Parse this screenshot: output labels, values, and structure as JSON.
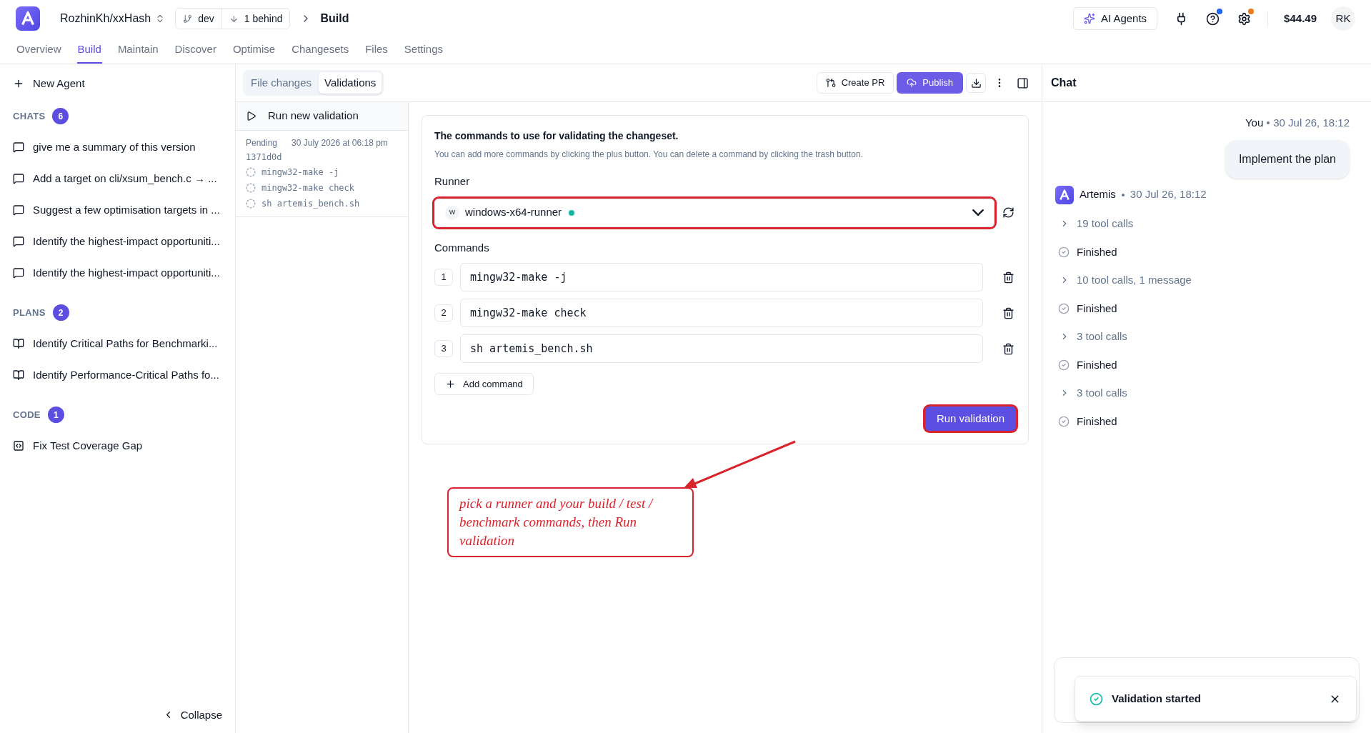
{
  "header": {
    "repo": "RozhinKh/xxHash",
    "branch": "dev",
    "behind": "1 behind",
    "breadcrumb": "Build",
    "ai_agents": "AI Agents",
    "icon_buttons": [
      {
        "kind": "plug"
      },
      {
        "kind": "help",
        "color": "#1d64f2"
      },
      {
        "kind": "settings",
        "color": "#ea7a1c"
      }
    ],
    "balance": "$44.49",
    "avatar": "RK"
  },
  "nav_tabs": [
    {
      "label": "Overview",
      "selected": false
    },
    {
      "label": "Build",
      "selected": true
    },
    {
      "label": "Maintain",
      "selected": false
    },
    {
      "label": "Discover",
      "selected": false
    },
    {
      "label": "Optimise",
      "selected": false
    },
    {
      "label": "Changesets",
      "selected": false
    },
    {
      "label": "Files",
      "selected": false
    },
    {
      "label": "Settings",
      "selected": false
    }
  ],
  "sidebar": {
    "new_agent": "New Agent",
    "collapse": "Collapse",
    "sections": [
      {
        "kind": "chat",
        "title": "CHATS",
        "count": "6",
        "items": [
          "give me a summary of this version",
          "Add a target on cli/xsum_bench.c → ...",
          "Suggest a few optimisation targets in ...",
          "Identify the highest-impact opportuniti...",
          "Identify the highest-impact opportuniti..."
        ]
      },
      {
        "kind": "plan",
        "title": "PLANS",
        "count": "2",
        "items": [
          "Identify Critical Paths for Benchmarki...",
          "Identify Performance-Critical Paths fo..."
        ]
      },
      {
        "kind": "code",
        "title": "CODE",
        "count": "1",
        "items": [
          "Fix Test Coverage Gap"
        ]
      }
    ]
  },
  "subtabs": [
    {
      "label": "File changes",
      "selected": false
    },
    {
      "label": "Validations",
      "selected": true
    }
  ],
  "toolbar": {
    "create_pr": "Create PR",
    "publish": "Publish"
  },
  "validations": {
    "run_new": "Run new validation",
    "runs": [
      {
        "status": "Pending",
        "date": "30 July 2026 at 06:18 pm",
        "commit": "1371d0d",
        "commands": [
          "mingw32-make -j",
          "mingw32-make check",
          "sh artemis_bench.sh"
        ]
      }
    ]
  },
  "form": {
    "title": "The commands to use for validating the changeset.",
    "hint": "You can add more commands by clicking the plus button. You can delete a command by clicking the trash button.",
    "runner_label": "Runner",
    "runner": {
      "initial": "W",
      "name": "windows-x64-runner",
      "online": true,
      "highlighted": true
    },
    "commands_label": "Commands",
    "commands": [
      {
        "number": "1",
        "value": "mingw32-make -j"
      },
      {
        "number": "2",
        "value": "mingw32-make check"
      },
      {
        "number": "3",
        "value": "sh artemis_bench.sh"
      }
    ],
    "add_command": "Add command",
    "run_button": {
      "label": "Run validation",
      "highlighted": true
    }
  },
  "callout": "pick a runner and your build / test / benchmark commands, then Run validation",
  "chat": {
    "title": "Chat",
    "user": {
      "author": "You",
      "time": "30 Jul 26, 18:12",
      "text": "Implement the plan"
    },
    "agent": {
      "name": "Artemis",
      "time": "30 Jul 26, 18:12",
      "steps": [
        {
          "kind": "tools",
          "label": "19 tool calls"
        },
        {
          "kind": "finished",
          "label": "Finished"
        },
        {
          "kind": "tools",
          "label": "10 tool calls, 1 message"
        },
        {
          "kind": "finished",
          "label": "Finished"
        },
        {
          "kind": "tools",
          "label": "3 tool calls"
        },
        {
          "kind": "finished",
          "label": "Finished"
        },
        {
          "kind": "tools",
          "label": "3 tool calls"
        },
        {
          "kind": "finished",
          "label": "Finished"
        }
      ]
    }
  },
  "toast": {
    "message": "Validation started"
  }
}
